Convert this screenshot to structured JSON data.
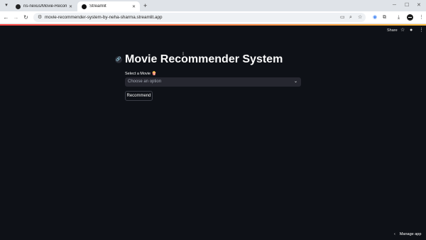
{
  "browser": {
    "tabs": [
      {
        "title": "ns-nexus/Movie-Recommend",
        "favicon": "github-icon",
        "active": false
      },
      {
        "title": "Streamlit",
        "favicon": "streamlit-icon",
        "active": true
      }
    ],
    "url": "movie-recommender-system-by-neha-sharma.streamlit.app"
  },
  "header": {
    "share_label": "Share"
  },
  "main": {
    "title": "Movie Recommender System",
    "select_label": "Select a Movie 🍿",
    "select_placeholder": "Choose an option",
    "button_label": "Recommend"
  },
  "footer": {
    "manage_app_label": "Manage app"
  },
  "colors": {
    "background": "#0e1117",
    "select_bg": "#262730",
    "text": "#fafafa",
    "accent": "#ff4b4b"
  }
}
